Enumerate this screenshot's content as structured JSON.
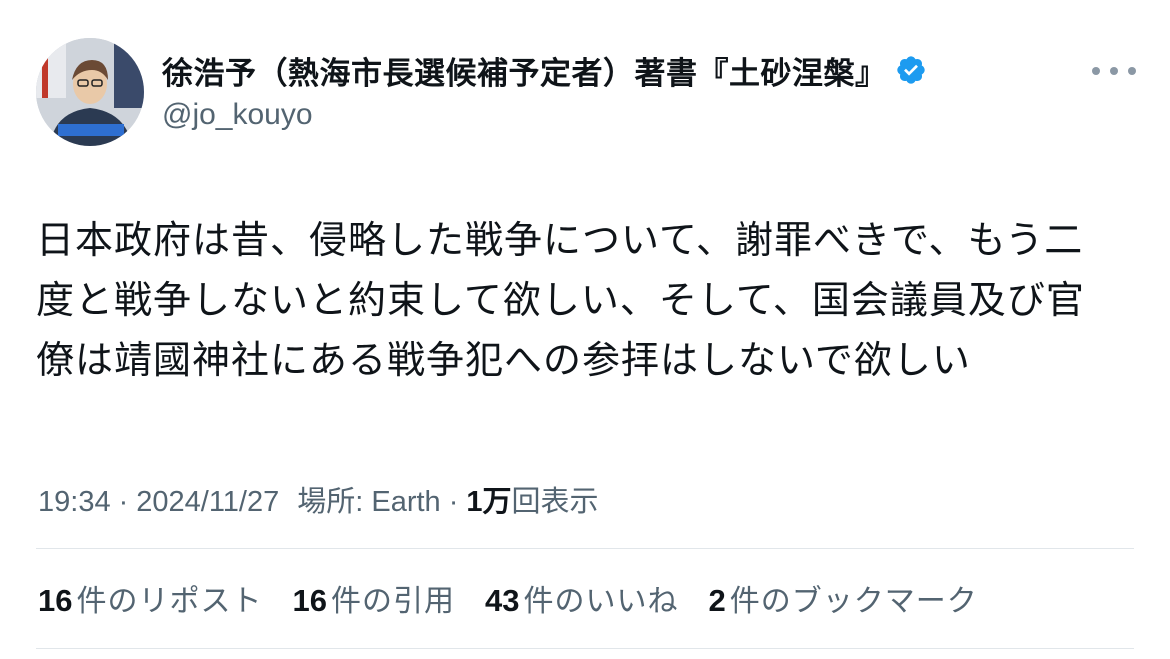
{
  "author": {
    "display_name": "徐浩予（熱海市長選候補予定者）著書『土砂涅槃』",
    "handle": "@jo_kouyo",
    "avatar_icon": "profile-photo-icon",
    "verified_color": "#1d9bf0"
  },
  "tweet": {
    "text": "日本政府は昔、侵略した戦争について、謝罪べきで、もう二\n度と戦争しないと約束して欲しい、そして、国会議員及び官\n僚は靖國神社にある戦争犯への参拝はしないで欲しい"
  },
  "meta": {
    "time": "19:34",
    "separator": "·",
    "date": "2024/11/27",
    "location": "場所: Earth",
    "views_count": "1万",
    "views_label": "回表示"
  },
  "stats": [
    {
      "count": "16",
      "label": "件のリポスト"
    },
    {
      "count": "16",
      "label": "件の引用"
    },
    {
      "count": "43",
      "label": "件のいいね"
    },
    {
      "count": "2",
      "label": "件のブックマーク"
    }
  ],
  "colors": {
    "text_primary": "#0f1419",
    "text_secondary": "#536471",
    "divider": "#e1e6ea",
    "verified": "#1d9bf0"
  }
}
